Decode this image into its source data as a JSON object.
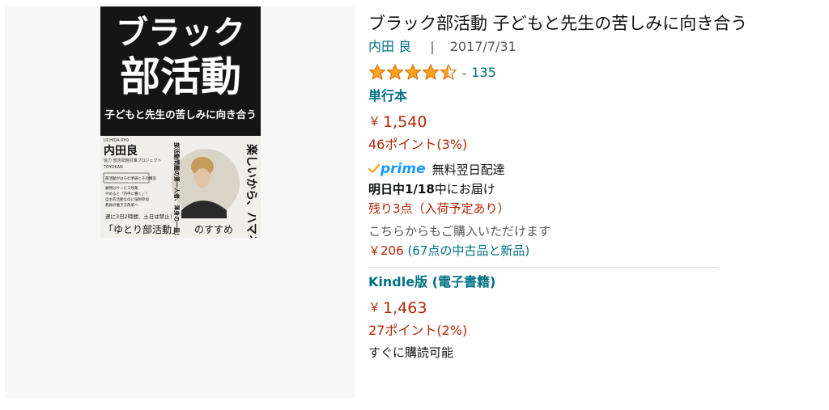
{
  "product": {
    "title": "ブラック部活動 子どもと先生の苦しみに向き合う",
    "author": "内田 良",
    "separator": "|",
    "date": "2017/7/31",
    "rating": {
      "value": 4.5,
      "count": "135"
    },
    "cover": {
      "title_top": "ブラック",
      "title_bottom": "部活動",
      "subtitle": "子どもと先生の苦しみに向き合う",
      "author_romaji": "UCHIDA RYO",
      "author": "内田良",
      "collab": "協力 部活問題対策プロジェクト",
      "publisher": "TOYOKAN",
      "tagline": "楽しいから、ハマる。",
      "badge": "部活動問題の第一人者、渾身の一冊！",
      "bullets_header": "部活動がはらむ矛盾とその構造",
      "bullets": [
        "顧問はサービス残業",
        "やめると「内申に響く」？",
        "自主的活動なのに強制参加",
        "教員の働き方改革へ"
      ],
      "weekly": "週に3日2時間、土日は禁止！",
      "bottom_quote": "「ゆとり部活動」",
      "bottom_suffix": "のすすめ"
    }
  },
  "paper": {
    "format": "単行本",
    "price": "1,540",
    "points": "46ポイント(3%)",
    "prime_text": "無料翌日配達",
    "delivery_bold": "明日中1/18",
    "delivery_rest": "中にお届け",
    "stock": "残り3点（入荷予定あり）",
    "other_sellers": "こちらからもご購入いただけます",
    "used_price": "206",
    "used_link": "(67点の中古品と新品)"
  },
  "kindle": {
    "format": "Kindle版 (電子書籍)",
    "price": "1,463",
    "points": "27ポイント(2%)",
    "availability": "すぐに購読可能"
  },
  "currency": "￥",
  "prime_label": "prime",
  "colors": {
    "price": "#b12704",
    "link": "#007185",
    "star": "#ffa41c",
    "prime": "#1a98ff"
  }
}
